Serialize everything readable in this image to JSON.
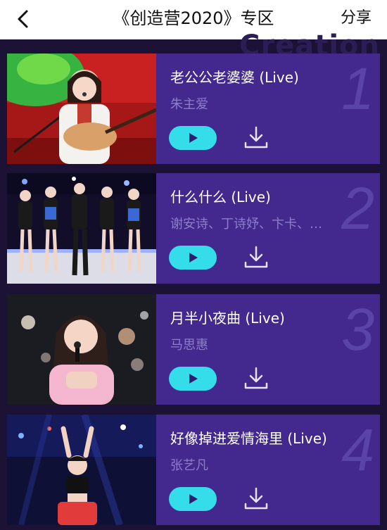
{
  "header": {
    "title": "《创造营2020》专区",
    "share_label": "分享"
  },
  "background_word": "Creation",
  "colors": {
    "card": "#43288e",
    "play_button": "#35dcea",
    "artist_text": "#8c7ec9",
    "rank_number": "#5a44a6"
  },
  "songs": [
    {
      "rank": "1",
      "title": "老公公老婆婆 (Live)",
      "artist": "朱主爱"
    },
    {
      "rank": "2",
      "title": "什么什么 (Live)",
      "artist": "谢安诗、丁诗妤、卞卡、…"
    },
    {
      "rank": "3",
      "title": "月半小夜曲 (Live)",
      "artist": "马思惠"
    },
    {
      "rank": "4",
      "title": "好像掉进爱情海里 (Live)",
      "artist": "张艺凡"
    }
  ],
  "icons": {
    "back": "chevron-left-icon",
    "play": "play-icon",
    "download": "download-icon"
  }
}
